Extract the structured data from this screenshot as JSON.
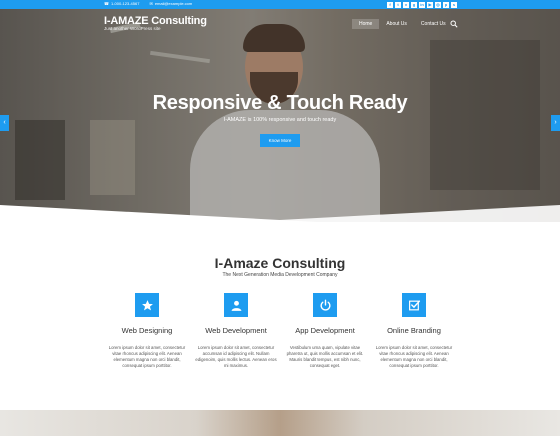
{
  "topbar": {
    "phone": "1-000-123-4567",
    "email": "email@example.com",
    "social_icons": [
      "facebook-icon",
      "twitter-icon",
      "vimeo-icon",
      "google-plus-icon",
      "linkedin-icon",
      "youtube-icon",
      "instagram-icon",
      "pinterest-icon",
      "skype-icon"
    ]
  },
  "logo": {
    "name": "I-AMAZE Consulting",
    "tagline": "Just another WordPress site"
  },
  "nav": {
    "items": [
      {
        "label": "Home",
        "active": true
      },
      {
        "label": "About Us",
        "active": false
      },
      {
        "label": "Contact Us",
        "active": false
      }
    ]
  },
  "hero": {
    "title": "Responsive & Touch Ready",
    "subtitle": "I-AMAZE is 100% responsive and touch ready",
    "button": "Know More"
  },
  "section": {
    "title": "I-Amaze Consulting",
    "subtitle": "The Next Generation Media Development Company"
  },
  "services": [
    {
      "title": "Web Designing",
      "icon": "star-icon",
      "desc": "Lorem ipsum dolor sit amet, consectetur vitae rhoncus adipiscing elit. Aenean elementum magna non orci blandit, consequat ipsum porttitor."
    },
    {
      "title": "Web Development",
      "icon": "user-icon",
      "desc": "Lorem ipsum dolor sit amet, consectetur accumsan id adipiscing elit. Nullam edigenoim, quis mollis lectus. Aenean eros mi maximus."
    },
    {
      "title": "App Development",
      "icon": "power-icon",
      "desc": "Vestibulum urna quam, vipulate vitae pharetra ut, quis mollis accumsan et elit. Mauris blandit tempus, est nibh nunc, consequat eget."
    },
    {
      "title": "Online Branding",
      "icon": "checkbox-icon",
      "desc": "Lorem ipsum dolor sit amet, consectetur vitae rhoncus adipiscing elit. Aenean elementum magna non orci blandit, consequat ipsum porttitor."
    }
  ],
  "colors": {
    "accent": "#1e9cf0",
    "heading": "#333333",
    "body_text": "#555555"
  }
}
